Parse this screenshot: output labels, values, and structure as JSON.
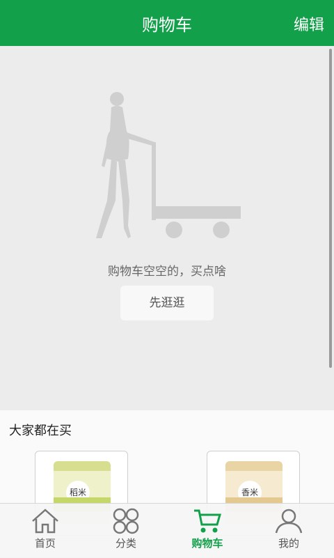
{
  "header": {
    "title": "购物车",
    "edit_label": "编辑"
  },
  "empty": {
    "message": "购物车空空的，买点啥",
    "browse_label": "先逛逛"
  },
  "recommend": {
    "title": "大家都在买",
    "products": [
      {
        "label_text": "稻米",
        "bag_color": "#eef1c9",
        "band_color": "#c6d76a"
      },
      {
        "label_text": "香米",
        "bag_color": "#f6ead0",
        "band_color": "#e3c98f"
      }
    ]
  },
  "tabbar": {
    "tabs": [
      {
        "label": "首页",
        "icon": "home-icon"
      },
      {
        "label": "分类",
        "icon": "category-icon"
      },
      {
        "label": "购物车",
        "icon": "cart-icon"
      },
      {
        "label": "我的",
        "icon": "user-icon"
      }
    ],
    "active": "购物车"
  },
  "colors": {
    "brand": "#12a14a"
  }
}
